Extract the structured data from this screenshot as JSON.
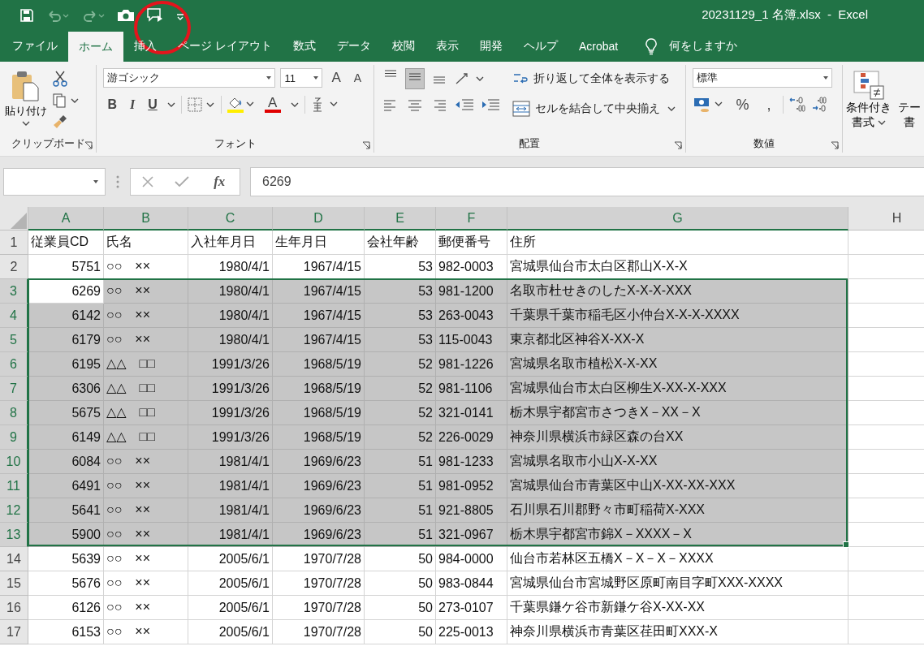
{
  "window": {
    "title": "20231129_1 名簿.xlsx  -  Excel"
  },
  "tabs": [
    {
      "label": "ファイル",
      "selected": false
    },
    {
      "label": "ホーム",
      "selected": true
    },
    {
      "label": "挿入",
      "selected": false
    },
    {
      "label": "ページ レイアウト",
      "selected": false
    },
    {
      "label": "数式",
      "selected": false
    },
    {
      "label": "データ",
      "selected": false
    },
    {
      "label": "校閲",
      "selected": false
    },
    {
      "label": "表示",
      "selected": false
    },
    {
      "label": "開発",
      "selected": false
    },
    {
      "label": "ヘルプ",
      "selected": false
    },
    {
      "label": "Acrobat",
      "selected": false
    }
  ],
  "tell_me": {
    "placeholder": "何をしますか"
  },
  "ribbon": {
    "clipboard": {
      "label": "クリップボード",
      "paste": "貼り付け"
    },
    "font": {
      "label": "フォント",
      "font_name": "游ゴシック",
      "font_size": "11",
      "grow": "A",
      "shrink": "A",
      "bold": "B",
      "italic": "I",
      "underline": "U",
      "font_color": "A"
    },
    "alignment": {
      "label": "配置",
      "wrap": "折り返して全体を表示する",
      "merge": "セルを結合して中央揃え",
      "vertical": [
        {
          "kind": "top",
          "selected": false
        },
        {
          "kind": "middle",
          "selected": true
        },
        {
          "kind": "bottom",
          "selected": false
        }
      ]
    },
    "number": {
      "label": "数値",
      "format": "標準",
      "percent": "%",
      "comma": ","
    },
    "styles": {
      "conditional_line1": "条件付き",
      "conditional_line2": "書式",
      "table_line1": "テー",
      "table_line2": "書"
    }
  },
  "formula_bar": {
    "fx": "fx",
    "value": "6269"
  },
  "sheet": {
    "columns": [
      {
        "label": "A",
        "selected": true
      },
      {
        "label": "B",
        "selected": true
      },
      {
        "label": "C",
        "selected": true
      },
      {
        "label": "D",
        "selected": true
      },
      {
        "label": "E",
        "selected": true
      },
      {
        "label": "F",
        "selected": true
      },
      {
        "label": "G",
        "selected": true
      },
      {
        "label": "H",
        "selected": false
      }
    ],
    "rows": [
      {
        "number": "1",
        "selected": false,
        "cells": [
          "従業員CD",
          "氏名",
          "入社年月日",
          "生年月日",
          "会社年齢",
          "郵便番号",
          "住所"
        ]
      },
      {
        "number": "2",
        "selected": false,
        "cells": [
          "5751",
          "○○　××",
          "1980/4/1",
          "1967/4/15",
          "53",
          "982-0003",
          "宮城県仙台市太白区郡山X-X-X"
        ]
      },
      {
        "number": "3",
        "selected": true,
        "cells": [
          "6269",
          "○○　××",
          "1980/4/1",
          "1967/4/15",
          "53",
          "981-1200",
          "名取市杜せきのしたX-X-X-XXX"
        ]
      },
      {
        "number": "4",
        "selected": true,
        "cells": [
          "6142",
          "○○　××",
          "1980/4/1",
          "1967/4/15",
          "53",
          "263-0043",
          "千葉県千葉市稲毛区小仲台X-X-X-XXXX"
        ]
      },
      {
        "number": "5",
        "selected": true,
        "cells": [
          "6179",
          "○○　××",
          "1980/4/1",
          "1967/4/15",
          "53",
          "115-0043",
          "東京都北区神谷X-XX-X"
        ]
      },
      {
        "number": "6",
        "selected": true,
        "cells": [
          "6195",
          "△△　□□",
          "1991/3/26",
          "1968/5/19",
          "52",
          "981-1226",
          "宮城県名取市植松X-X-XX"
        ]
      },
      {
        "number": "7",
        "selected": true,
        "cells": [
          "6306",
          "△△　□□",
          "1991/3/26",
          "1968/5/19",
          "52",
          "981-1106",
          "宮城県仙台市太白区柳生X-XX-X-XXX"
        ]
      },
      {
        "number": "8",
        "selected": true,
        "cells": [
          "5675",
          "△△　□□",
          "1991/3/26",
          "1968/5/19",
          "52",
          "321-0141",
          "栃木県宇都宮市さつきX－XX－X"
        ]
      },
      {
        "number": "9",
        "selected": true,
        "cells": [
          "6149",
          "△△　□□",
          "1991/3/26",
          "1968/5/19",
          "52",
          "226-0029",
          "神奈川県横浜市緑区森の台XX"
        ]
      },
      {
        "number": "10",
        "selected": true,
        "cells": [
          "6084",
          "○○　××",
          "1981/4/1",
          "1969/6/23",
          "51",
          "981-1233",
          "宮城県名取市小山X-X-XX"
        ]
      },
      {
        "number": "11",
        "selected": true,
        "cells": [
          "6491",
          "○○　××",
          "1981/4/1",
          "1969/6/23",
          "51",
          "981-0952",
          "宮城県仙台市青葉区中山X-XX-XX-XXX"
        ]
      },
      {
        "number": "12",
        "selected": true,
        "cells": [
          "5641",
          "○○　××",
          "1981/4/1",
          "1969/6/23",
          "51",
          "921-8805",
          "石川県石川郡野々市町稲荷X-XXX"
        ]
      },
      {
        "number": "13",
        "selected": true,
        "cells": [
          "5900",
          "○○　××",
          "1981/4/1",
          "1969/6/23",
          "51",
          "321-0967",
          "栃木県宇都宮市錦X－XXXX－X"
        ]
      },
      {
        "number": "14",
        "selected": false,
        "cells": [
          "5639",
          "○○　××",
          "2005/6/1",
          "1970/7/28",
          "50",
          "984-0000",
          "仙台市若林区五橋X－X－X－XXXX"
        ]
      },
      {
        "number": "15",
        "selected": false,
        "cells": [
          "5676",
          "○○　××",
          "2005/6/1",
          "1970/7/28",
          "50",
          "983-0844",
          "宮城県仙台市宮城野区原町南目字町XXX-XXXX"
        ]
      },
      {
        "number": "16",
        "selected": false,
        "cells": [
          "6126",
          "○○　××",
          "2005/6/1",
          "1970/7/28",
          "50",
          "273-0107",
          "千葉県鎌ケ谷市新鎌ケ谷X-XX-XX"
        ]
      },
      {
        "number": "17",
        "selected": false,
        "cells": [
          "6153",
          "○○　××",
          "2005/6/1",
          "1970/7/28",
          "50",
          "225-0013",
          "神奈川県横浜市青葉区荏田町XXX-X"
        ]
      }
    ]
  }
}
